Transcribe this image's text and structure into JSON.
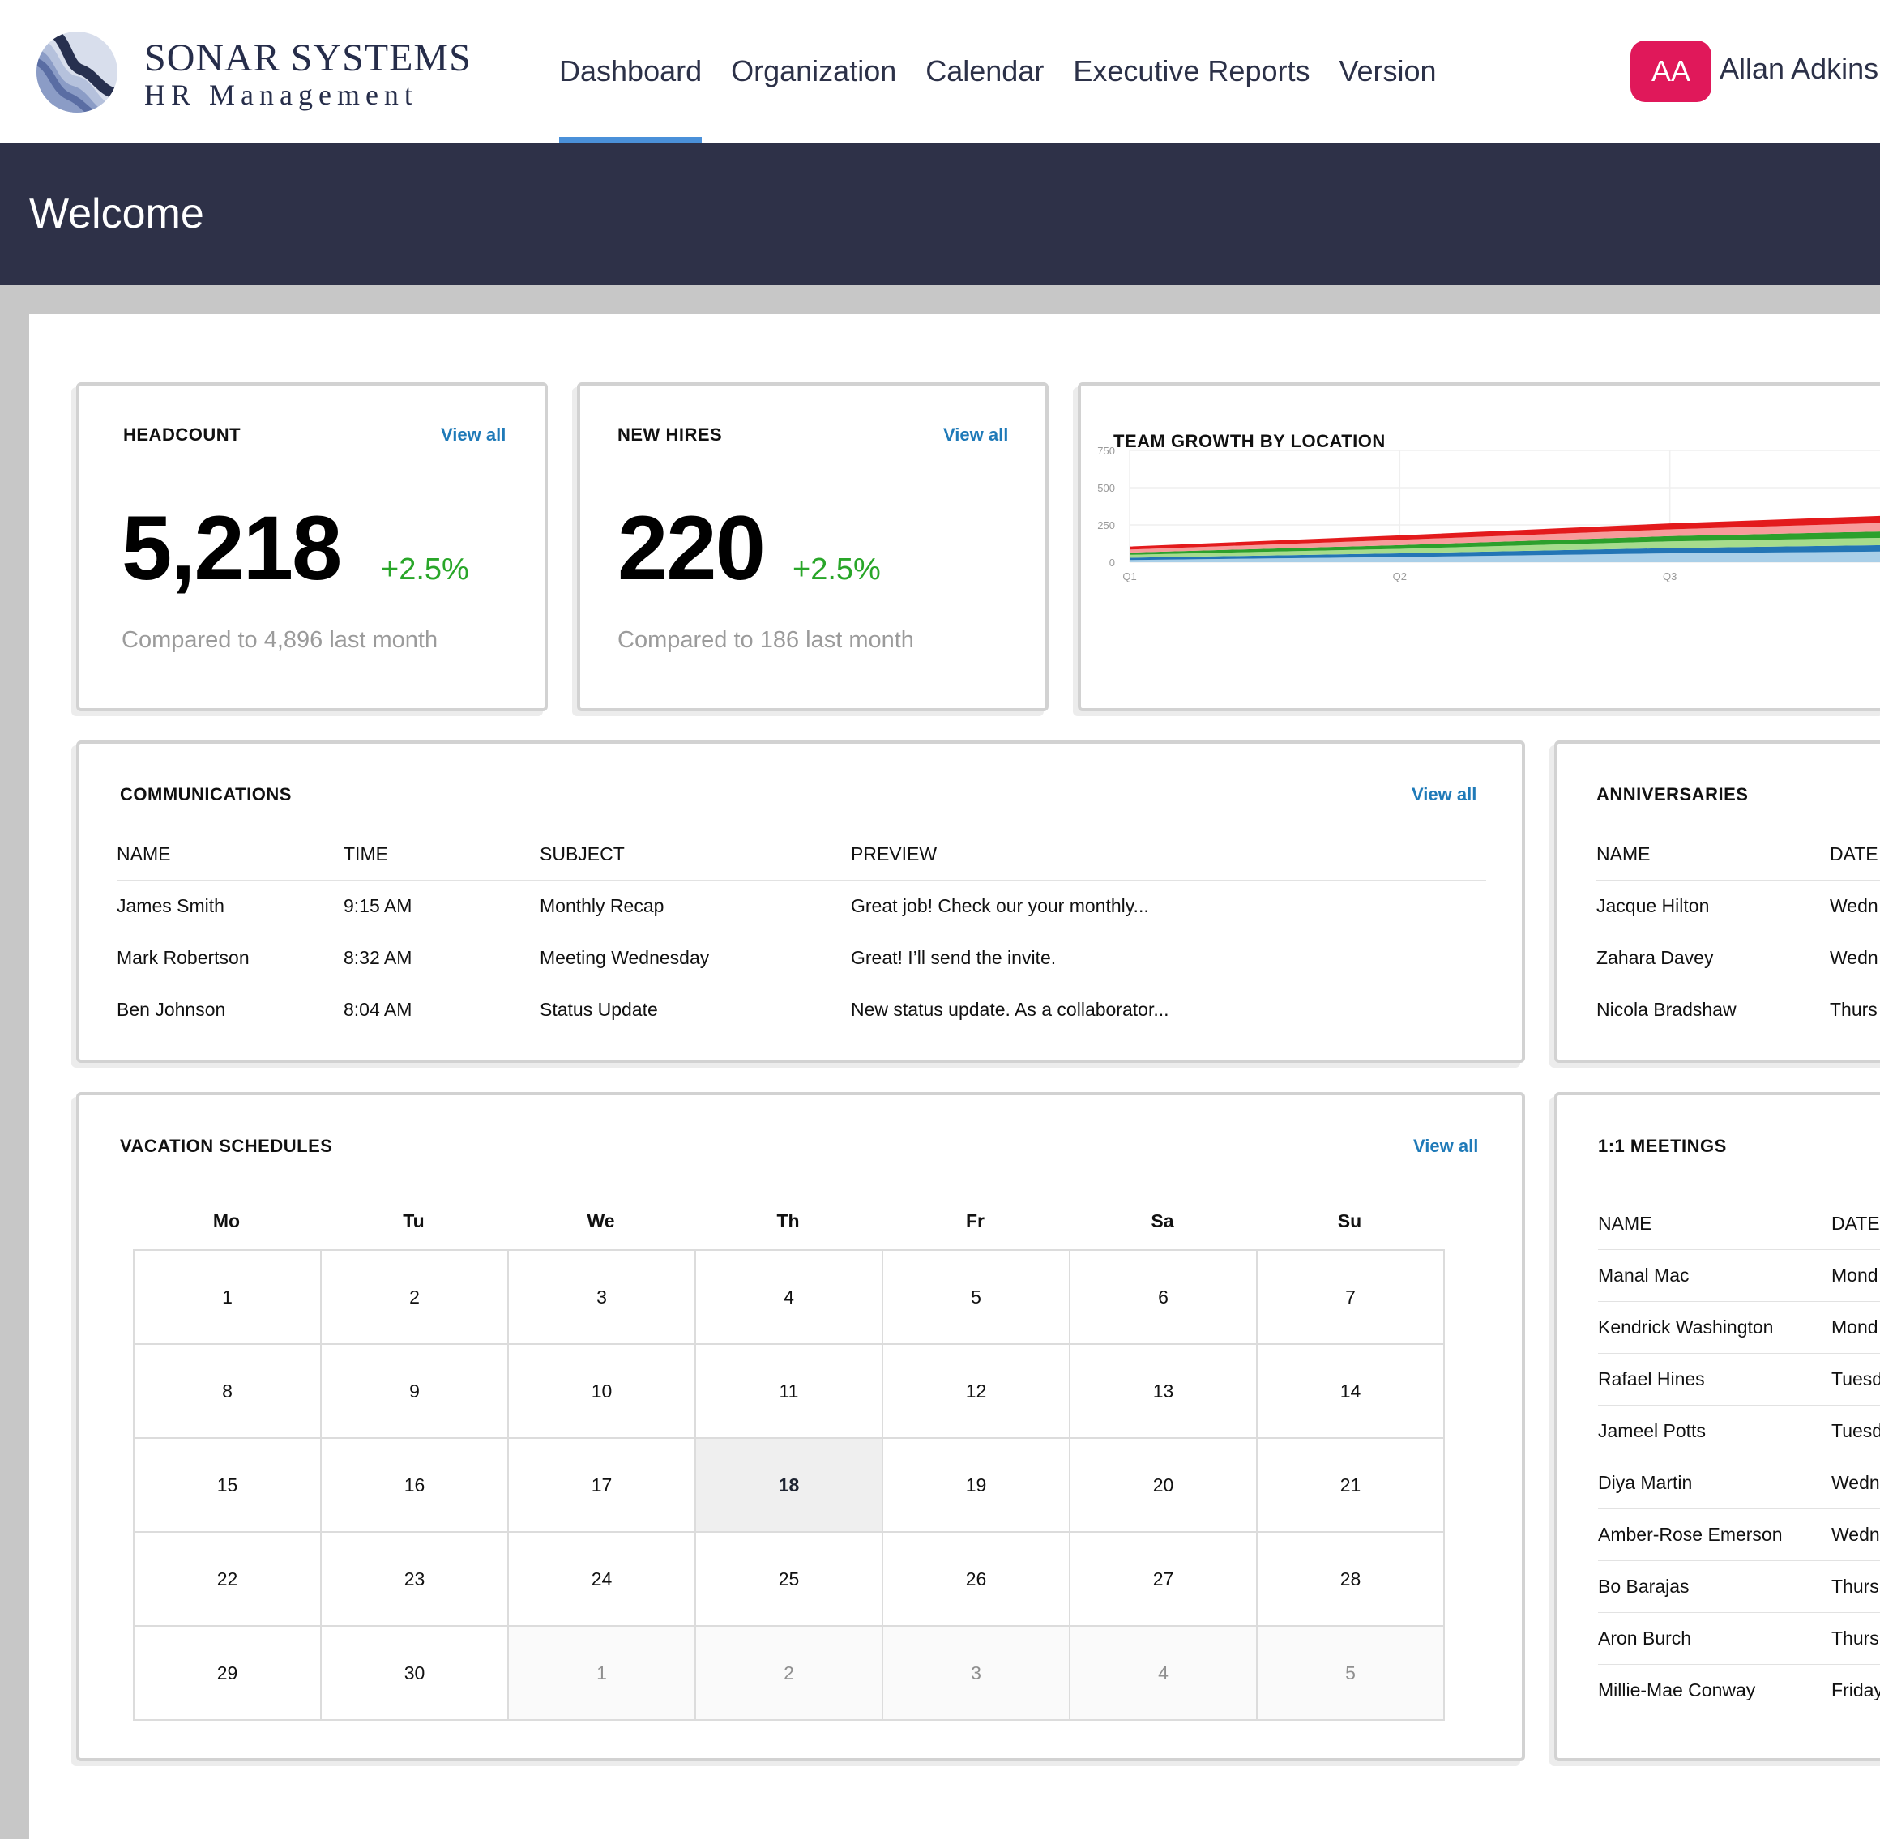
{
  "brand": {
    "name": "SONAR SYSTEMS",
    "subtitle": "HR Management"
  },
  "nav": {
    "items": [
      "Dashboard",
      "Organization",
      "Calendar",
      "Executive Reports",
      "Version"
    ],
    "active": "Dashboard"
  },
  "user": {
    "initials": "AA",
    "name": "Allan Adkins",
    "avatar_color": "#e0185a"
  },
  "welcome": {
    "title": "Welcome"
  },
  "headcount": {
    "title": "HEADCOUNT",
    "view_all": "View all",
    "value": "5,218",
    "change": "+2.5%",
    "compare": "Compared to 4,896 last month"
  },
  "new_hires": {
    "title": "NEW HIRES",
    "view_all": "View all",
    "value": "220",
    "change": "+2.5%",
    "compare": "Compared to 186 last month"
  },
  "team_growth": {
    "title": "TEAM GROWTH BY LOCATION"
  },
  "chart_data": {
    "type": "area",
    "stacked": true,
    "categories": [
      "Q1",
      "Q2",
      "Q3"
    ],
    "ylim": [
      0,
      750
    ],
    "yticks": [
      "750",
      "500",
      "250",
      "0"
    ],
    "grid": true,
    "series": [
      {
        "color": "#a9cfe8",
        "values": [
          15,
          35,
          60,
          75
        ]
      },
      {
        "color": "#2375b5",
        "values": [
          15,
          25,
          35,
          45
        ]
      },
      {
        "color": "#a6dc8c",
        "values": [
          20,
          30,
          45,
          50
        ]
      },
      {
        "color": "#2ca02c",
        "values": [
          15,
          25,
          35,
          45
        ]
      },
      {
        "color": "#f89b9b",
        "values": [
          20,
          35,
          45,
          60
        ]
      },
      {
        "color": "#e31a1c",
        "values": [
          20,
          30,
          40,
          50
        ]
      }
    ]
  },
  "communications": {
    "title": "COMMUNICATIONS",
    "view_all": "View all",
    "columns": [
      "NAME",
      "TIME",
      "SUBJECT",
      "PREVIEW"
    ],
    "rows": [
      [
        "James Smith",
        "9:15 AM",
        "Monthly Recap",
        "Great job!  Check our your monthly..."
      ],
      [
        "Mark Robertson",
        "8:32 AM",
        "Meeting Wednesday",
        "Great!  I’ll send the invite."
      ],
      [
        "Ben Johnson",
        "8:04 AM",
        "Status Update",
        "New status update.  As a collaborator..."
      ]
    ]
  },
  "anniversaries": {
    "title": "ANNIVERSARIES",
    "columns": [
      "NAME",
      "DATE"
    ],
    "rows": [
      [
        "Jacque Hilton",
        "Wedn"
      ],
      [
        "Zahara Davey",
        "Wedn"
      ],
      [
        "Nicola Bradshaw",
        "Thurs"
      ]
    ]
  },
  "vacation": {
    "title": "VACATION SCHEDULES",
    "view_all": "View all",
    "weekdays": [
      "Mo",
      "Tu",
      "We",
      "Th",
      "Fr",
      "Sa",
      "Su"
    ],
    "days": [
      {
        "d": "1"
      },
      {
        "d": "2"
      },
      {
        "d": "3"
      },
      {
        "d": "4"
      },
      {
        "d": "5"
      },
      {
        "d": "6"
      },
      {
        "d": "7"
      },
      {
        "d": "8"
      },
      {
        "d": "9"
      },
      {
        "d": "10"
      },
      {
        "d": "11"
      },
      {
        "d": "12"
      },
      {
        "d": "13"
      },
      {
        "d": "14"
      },
      {
        "d": "15"
      },
      {
        "d": "16"
      },
      {
        "d": "17"
      },
      {
        "d": "18",
        "today": true
      },
      {
        "d": "19"
      },
      {
        "d": "20"
      },
      {
        "d": "21"
      },
      {
        "d": "22"
      },
      {
        "d": "23"
      },
      {
        "d": "24"
      },
      {
        "d": "25"
      },
      {
        "d": "26"
      },
      {
        "d": "27"
      },
      {
        "d": "28"
      },
      {
        "d": "29"
      },
      {
        "d": "30"
      },
      {
        "d": "1",
        "muted": true
      },
      {
        "d": "2",
        "muted": true
      },
      {
        "d": "3",
        "muted": true
      },
      {
        "d": "4",
        "muted": true
      },
      {
        "d": "5",
        "muted": true
      }
    ]
  },
  "meetings": {
    "title": "1:1 MEETINGS",
    "columns": [
      "NAME",
      "DATE"
    ],
    "rows": [
      [
        "Manal Mac",
        "Mond"
      ],
      [
        "Kendrick Washington",
        "Mond"
      ],
      [
        "Rafael Hines",
        "Tuesd"
      ],
      [
        "Jameel Potts",
        "Tuesd"
      ],
      [
        "Diya Martin",
        "Wedn"
      ],
      [
        "Amber-Rose Emerson",
        "Wedn"
      ],
      [
        "Bo Barajas",
        "Thurs"
      ],
      [
        "Aron Burch",
        "Thurs"
      ],
      [
        "Millie-Mae Conway",
        "Friday"
      ]
    ]
  }
}
